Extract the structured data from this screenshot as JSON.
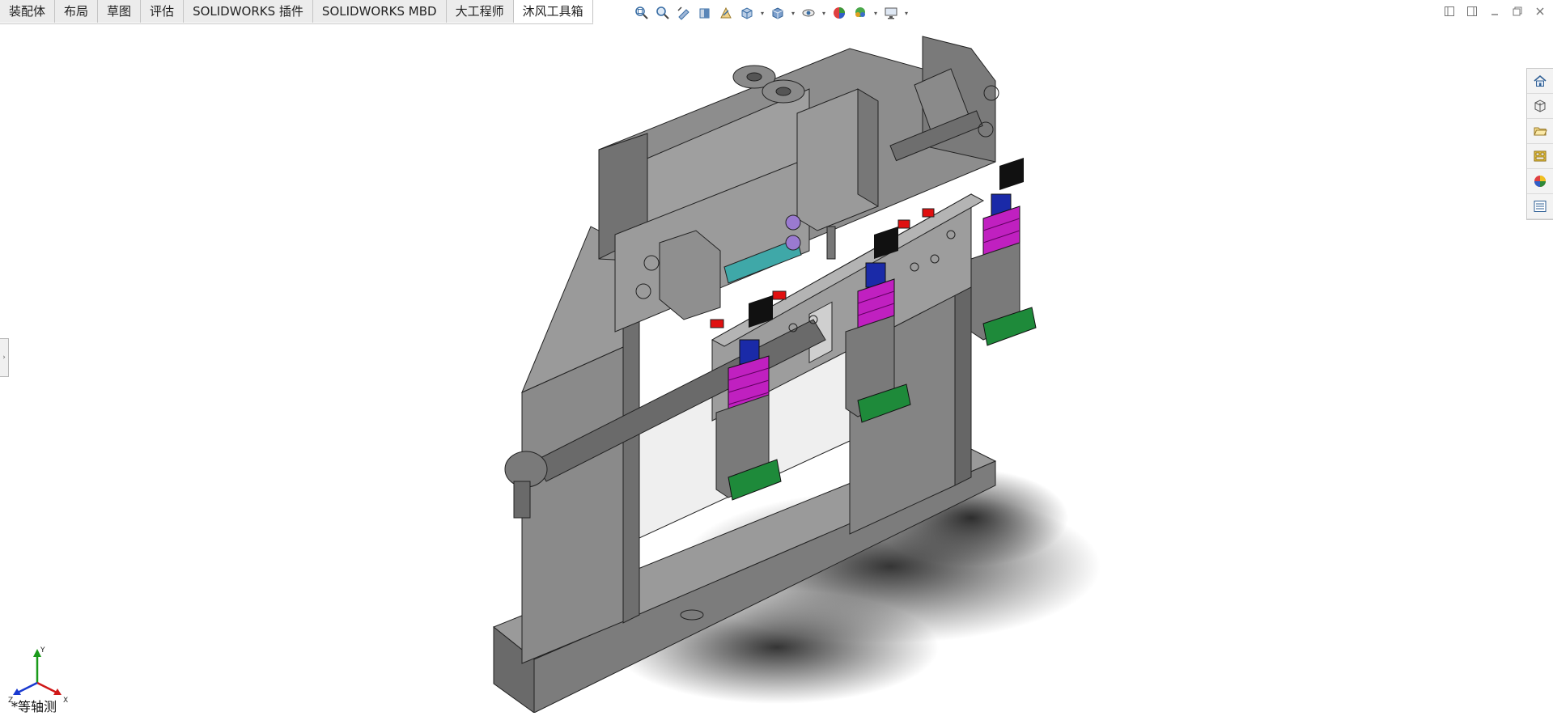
{
  "tabs": [
    {
      "label": "装配体",
      "active": false
    },
    {
      "label": "布局",
      "active": false
    },
    {
      "label": "草图",
      "active": false
    },
    {
      "label": "评估",
      "active": false
    },
    {
      "label": "SOLIDWORKS 插件",
      "active": false
    },
    {
      "label": "SOLIDWORKS MBD",
      "active": false
    },
    {
      "label": "大工程师",
      "active": false
    },
    {
      "label": "沐风工具箱",
      "active": true
    }
  ],
  "view_toolbar": {
    "icons": [
      "zoom-to-fit-icon",
      "zoom-to-area-icon",
      "previous-view-icon",
      "section-view-icon",
      "dynamic-annotation-icon",
      "view-orientation-icon",
      "display-style-icon",
      "hide-show-items-icon",
      "edit-appearance-icon",
      "apply-scene-icon",
      "view-settings-icon"
    ]
  },
  "task_pane": {
    "icons": [
      "home-icon",
      "parts-3d-icon",
      "file-explorer-icon",
      "view-palette-icon",
      "appearances-icon",
      "custom-properties-icon"
    ]
  },
  "triad": {
    "x_label": "X",
    "y_label": "Y",
    "z_label": "Z"
  },
  "view_name": "*等轴测",
  "colors": {
    "model_gray": "#7a7a7a",
    "spring_magenta": "#c020c0",
    "sensor_blue": "#1a2aa8",
    "cylinder_teal": "#3fa8a8",
    "accent_red": "#e01010",
    "pcb_green": "#1e8a3a"
  }
}
